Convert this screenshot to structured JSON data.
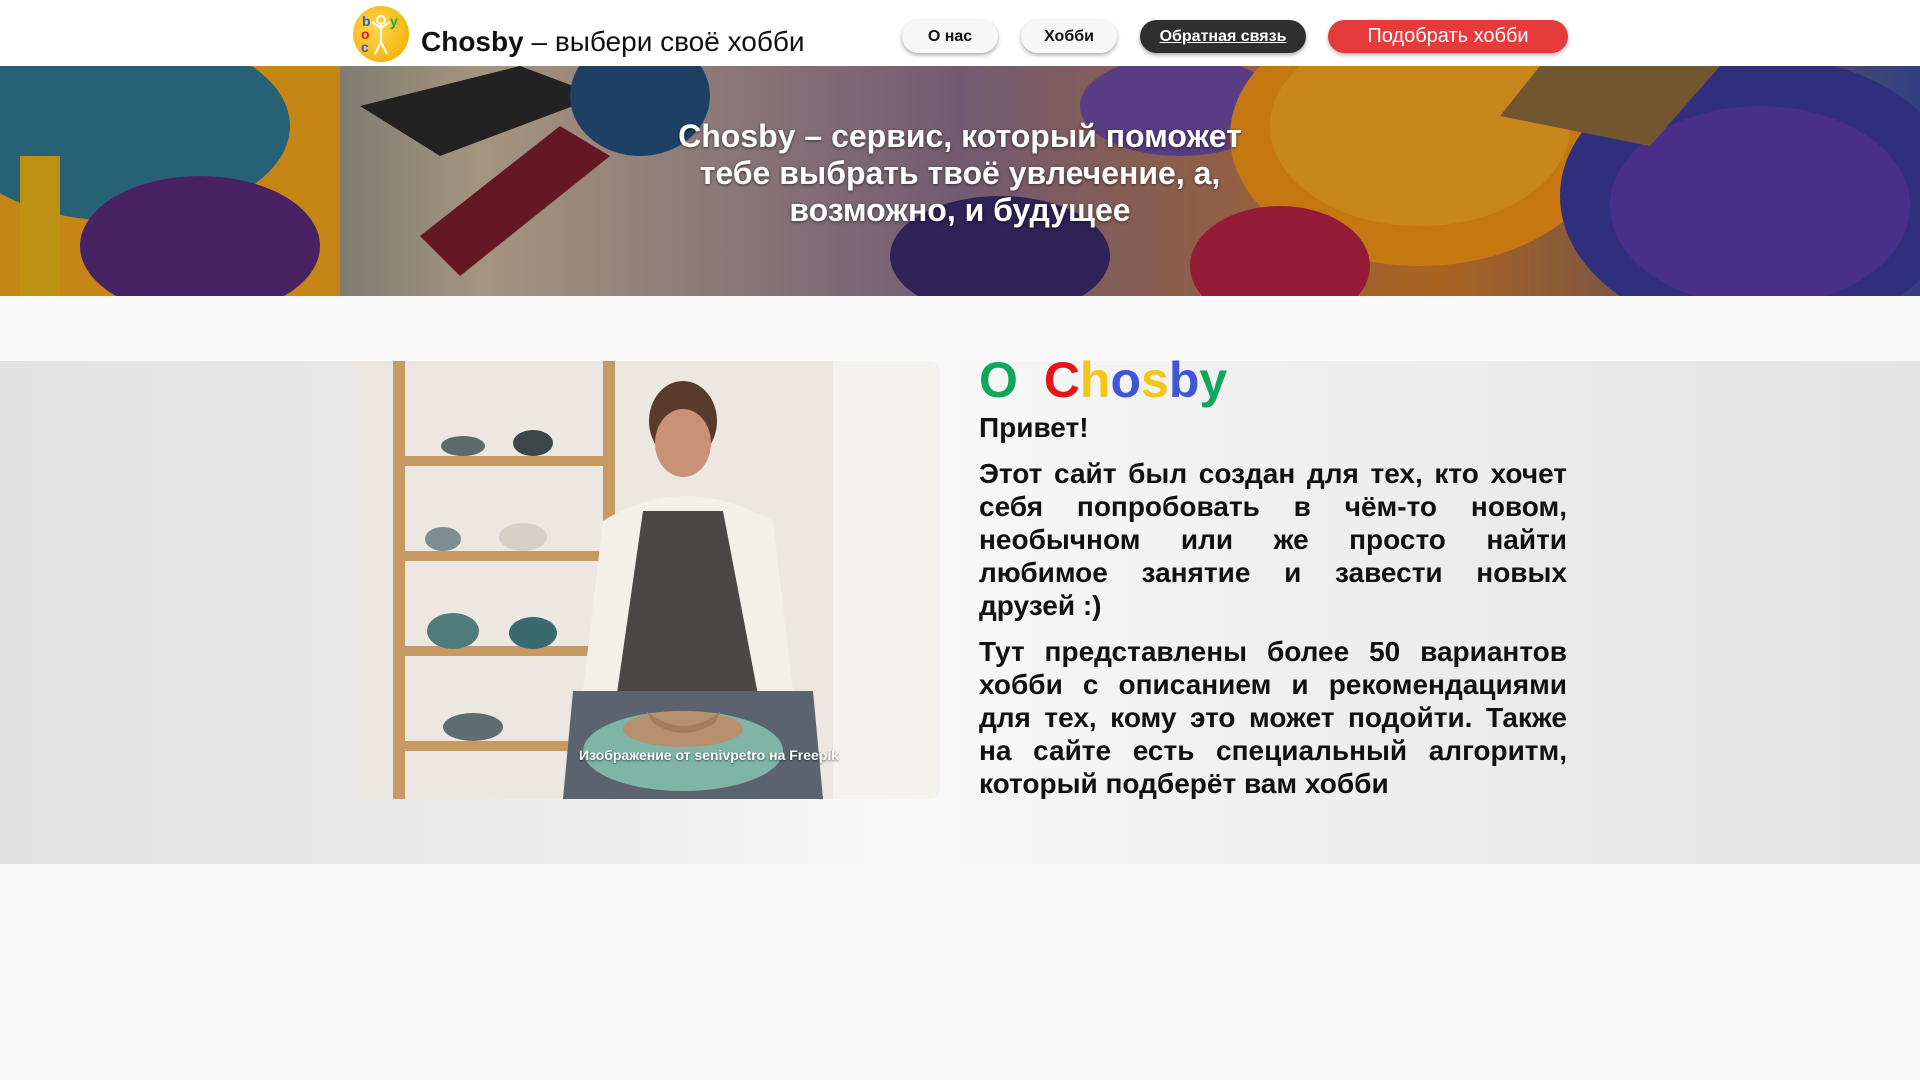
{
  "header": {
    "brand_name": "Chosby",
    "brand_tagline": "– выбери своё хобби",
    "nav": {
      "about": "О нас",
      "hobbies": "Хобби",
      "feedback": "Обратная связь",
      "pick_hobby": "Подобрать хобби"
    },
    "logo_letters": [
      "b",
      "y",
      "o",
      "c"
    ]
  },
  "hero": {
    "text": "Chosby – сервис, который поможет тебе выбрать твоё увлечение, а, возможно, и будущее"
  },
  "about": {
    "title_prefix": "О",
    "title_letters": [
      "C",
      "h",
      "o",
      "s",
      "b",
      "y"
    ],
    "title_colors": [
      "#0fa85b",
      "#e8141c",
      "#f5c518",
      "#4156d6",
      "#f5c518",
      "#4156d6",
      "#0fa85b"
    ],
    "greeting": "Привет!",
    "paragraph1": "Этот сайт был создан для тех, кто хочет себя попробовать в чём-то новом, необычном или же просто найти любимое занятие и завести новых друзей :)",
    "paragraph2": "Тут представлены более 50 вариантов хобби с описанием и рекомендациями для тех, кому это может подойти. Также на сайте есть специальный алгоритм, который подберёт вам хобби",
    "photo_credit": "Изображение от senivpetro на Freepik"
  },
  "colors": {
    "cta_red": "#e73a3a",
    "dark_button": "#2f2f2f",
    "logo_yellow": "#f5b40f"
  }
}
